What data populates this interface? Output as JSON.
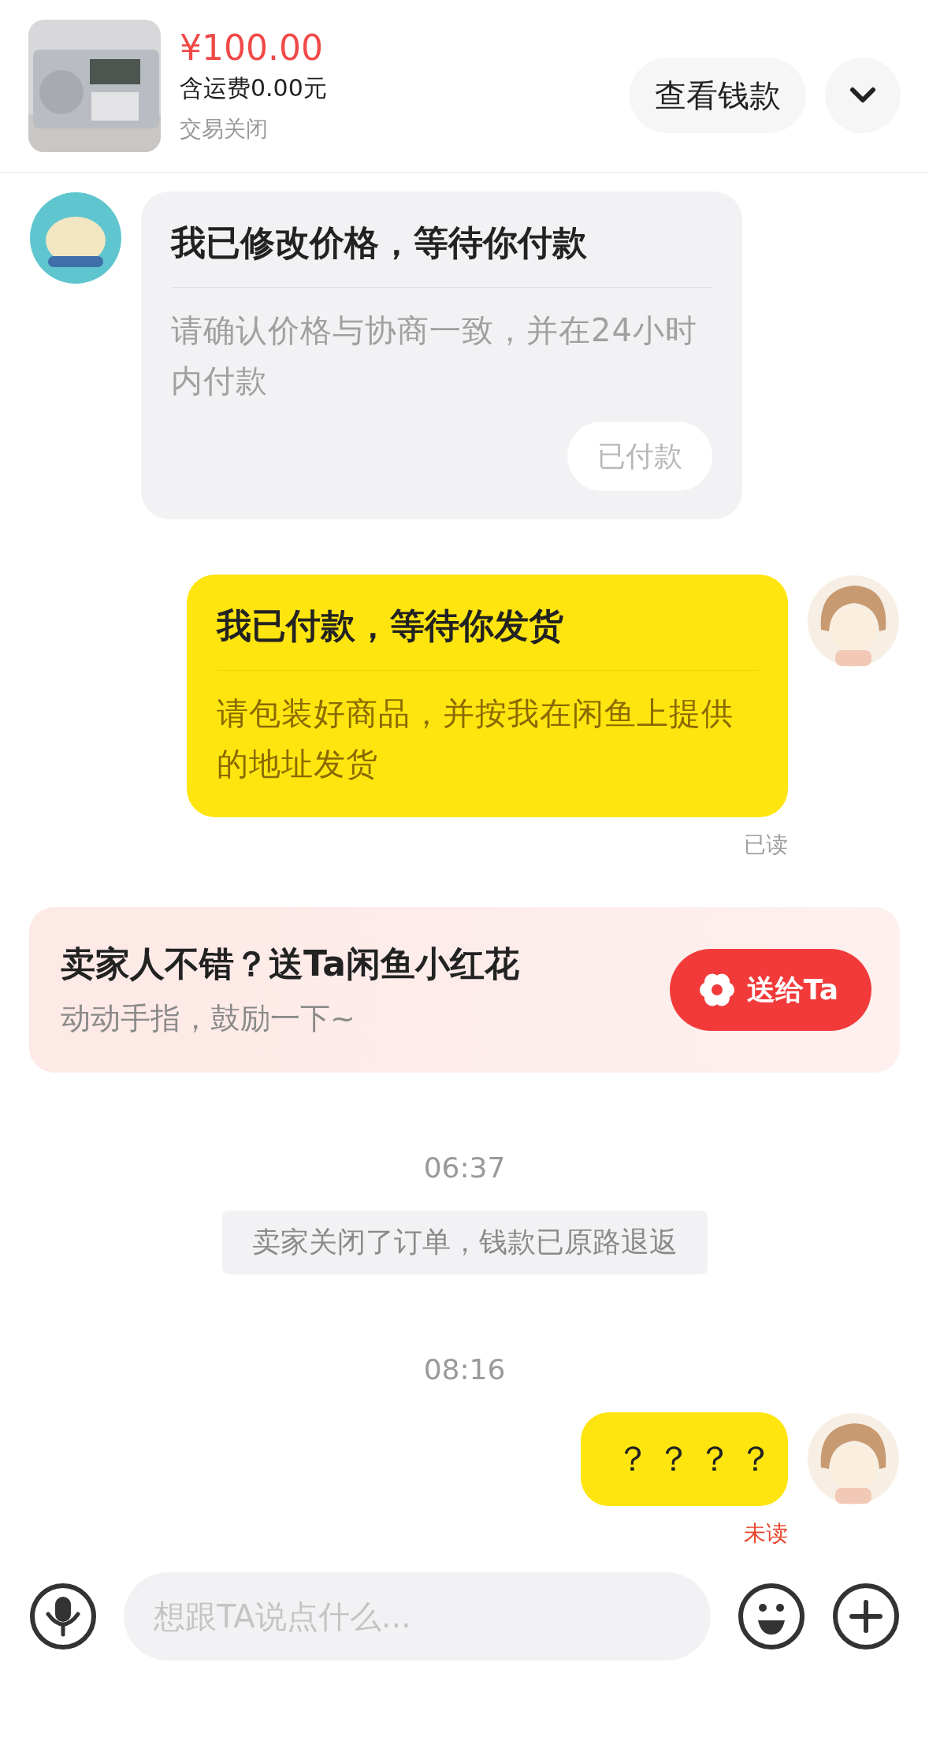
{
  "header": {
    "price": "¥100.00",
    "shipping": "含运费0.00元",
    "status": "交易关闭",
    "view_funds_button": "查看钱款"
  },
  "messages": [
    {
      "kind": "card",
      "from_me": false,
      "title": "我已修改价格，等待你付款",
      "body": "请确认价格与协商一致，并在24小时内付款",
      "action": "已付款"
    },
    {
      "kind": "card",
      "from_me": true,
      "title": "我已付款，等待你发货",
      "body": "请包装好商品，并按我在闲鱼上提供的地址发货",
      "receipt": "已读",
      "read": true
    },
    {
      "kind": "promo",
      "title": "卖家人不错？送Ta闲鱼小红花",
      "subtitle": "动动手指，鼓励一下~",
      "button": "送给Ta"
    },
    {
      "kind": "time",
      "text": "06:37"
    },
    {
      "kind": "notice",
      "text": "卖家关闭了订单，钱款已原路退返"
    },
    {
      "kind": "time",
      "text": "08:16"
    },
    {
      "kind": "text",
      "from_me": true,
      "text": "？？？？",
      "receipt": "未读",
      "read": false
    }
  ],
  "composer": {
    "placeholder": "想跟TA说点什么..."
  }
}
